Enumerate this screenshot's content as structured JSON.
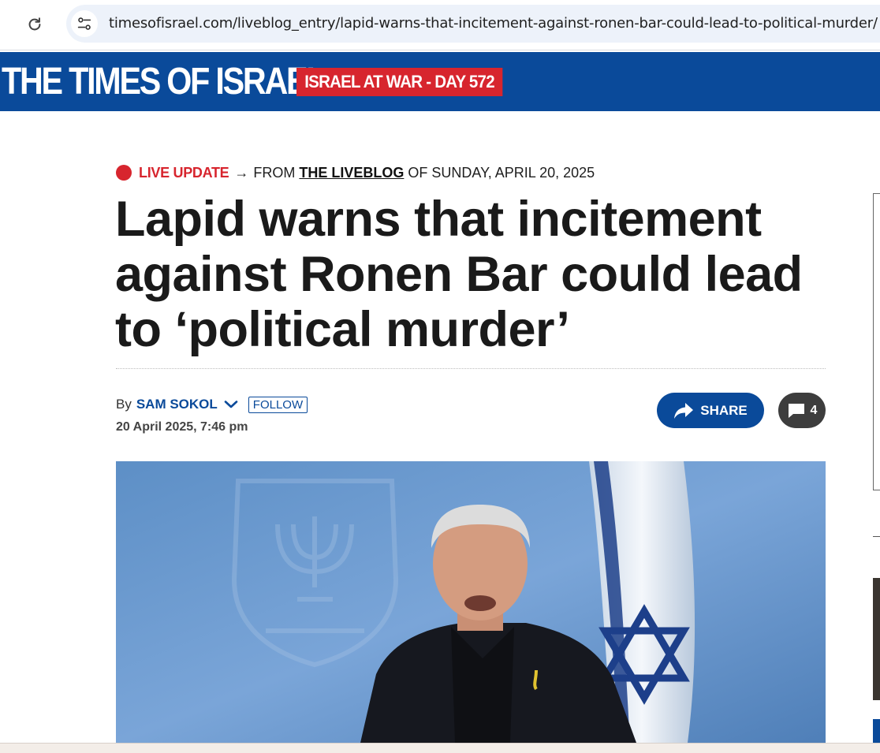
{
  "browser": {
    "url": "timesofisrael.com/liveblog_entry/lapid-warns-that-incitement-against-ronen-bar-could-lead-to-political-murder/"
  },
  "masthead": {
    "logo_text": "THE TIMES OF ISRAEL",
    "badge_text": "ISRAEL AT WAR - DAY 572"
  },
  "kicker": {
    "live_label": "LIVE UPDATE",
    "arrow": "→",
    "from_text": "FROM",
    "liveblog_link": "THE LIVEBLOG",
    "date_text": "OF SUNDAY, APRIL 20, 2025"
  },
  "article": {
    "headline": "Lapid warns that incitement against Ronen Bar could lead to ‘political murder’",
    "by_label": "By",
    "author": "SAM SOKOL",
    "follow_label": "FOLLOW",
    "published": "20 April 2025, 7:46 pm",
    "share_label": "SHARE",
    "comment_count": "4"
  },
  "icons": {
    "reload": "reload-icon",
    "site_info": "site-settings-icon",
    "chevron": "chevron-down-icon",
    "share": "share-arrow-icon",
    "comments": "comment-bubble-icon"
  },
  "colors": {
    "brand_blue": "#0a4a9a",
    "live_red": "#d7252e",
    "comments_gray": "#3d3d3d"
  }
}
